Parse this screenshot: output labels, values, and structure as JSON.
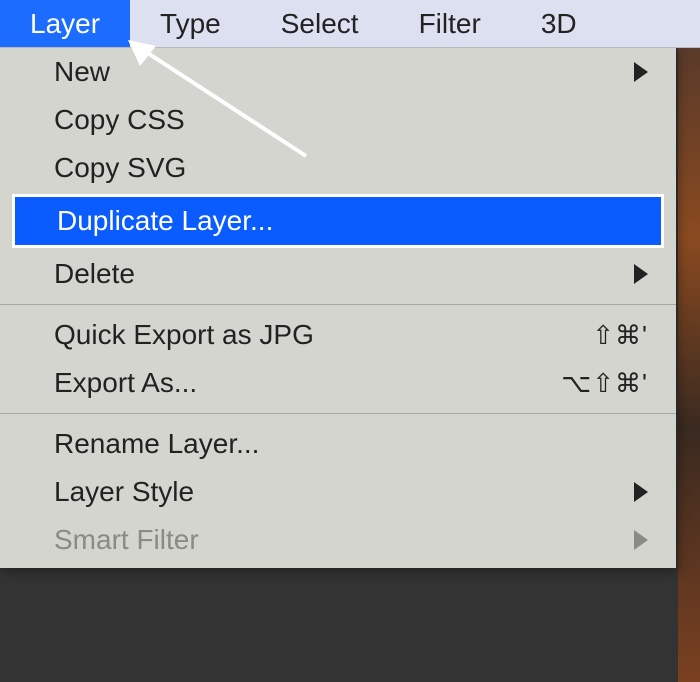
{
  "menubar": {
    "items": [
      {
        "label": "Layer",
        "active": true
      },
      {
        "label": "Type"
      },
      {
        "label": "Select"
      },
      {
        "label": "Filter"
      },
      {
        "label": "3D"
      }
    ]
  },
  "dropdown": {
    "items": [
      {
        "label": "New",
        "submenu": true
      },
      {
        "label": "Copy CSS"
      },
      {
        "label": "Copy SVG"
      },
      {
        "label": "Duplicate Layer...",
        "highlighted": true
      },
      {
        "label": "Delete",
        "submenu": true
      },
      {
        "type": "separator"
      },
      {
        "label": "Quick Export as JPG",
        "shortcut": "⇧⌘'"
      },
      {
        "label": "Export As...",
        "shortcut": "⌥⇧⌘'"
      },
      {
        "type": "separator"
      },
      {
        "label": "Rename Layer..."
      },
      {
        "label": "Layer Style",
        "submenu": true
      },
      {
        "label": "Smart Filter",
        "submenu": true,
        "disabled": true
      }
    ]
  }
}
